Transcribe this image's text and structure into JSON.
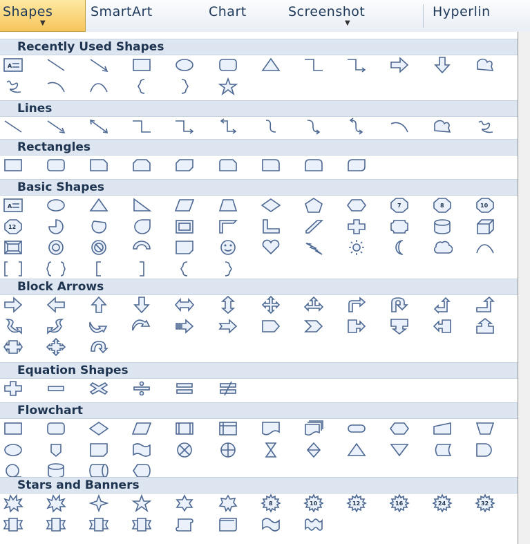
{
  "ribbon": {
    "shapes_label": "Shapes",
    "smartart_label": "SmartArt",
    "chart_label": "Chart",
    "screenshot_label": "Screenshot",
    "hyperlink_label": "Hyperlin"
  },
  "sections": [
    {
      "title": "Recently Used Shapes",
      "rows": [
        [
          "text-box",
          "line",
          "arrow-line",
          "rectangle",
          "oval",
          "rounded-rectangle",
          "triangle",
          "elbow-connector",
          "elbow-arrow-connector",
          "right-arrow",
          "down-arrow",
          "freeform"
        ],
        [
          "scribble",
          "curve",
          "arc",
          "left-brace",
          "right-brace",
          "star-5-point"
        ]
      ]
    },
    {
      "title": "Lines",
      "rows": [
        [
          "line",
          "arrow-line",
          "double-arrow-line",
          "elbow-connector",
          "elbow-arrow-connector",
          "elbow-double-arrow-connector",
          "curved-connector",
          "curved-arrow-connector",
          "curved-double-arrow-connector",
          "curve",
          "freeform",
          "scribble"
        ]
      ]
    },
    {
      "title": "Rectangles",
      "rows": [
        [
          "rectangle",
          "rounded-rectangle",
          "snip-single-corner-rectangle",
          "snip-same-side-corner-rectangle",
          "snip-diagonal-corner-rectangle",
          "snip-and-round-single-corner-rectangle",
          "round-single-corner-rectangle",
          "round-same-side-corner-rectangle",
          "round-diagonal-corner-rectangle"
        ]
      ]
    },
    {
      "title": "Basic Shapes",
      "rows": [
        [
          "text-box",
          "oval",
          "isosceles-triangle",
          "right-triangle",
          "parallelogram",
          "trapezoid",
          "diamond",
          "pentagon",
          "hexagon",
          "heptagon",
          "octagon",
          "decagon"
        ],
        [
          "dodecagon",
          "pie",
          "chord",
          "teardrop",
          "frame",
          "half-frame",
          "l-shape",
          "diagonal-stripe",
          "cross",
          "plaque",
          "can",
          "cube"
        ],
        [
          "bevel",
          "donut",
          "no-symbol",
          "block-arc",
          "folded-corner",
          "smiley-face",
          "heart",
          "lightning-bolt",
          "sun",
          "moon",
          "cloud",
          "arc"
        ],
        [
          "double-bracket",
          "double-brace",
          "left-bracket",
          "right-bracket",
          "left-brace",
          "right-brace"
        ]
      ]
    },
    {
      "title": "Block Arrows",
      "rows": [
        [
          "right-arrow",
          "left-arrow",
          "up-arrow",
          "down-arrow",
          "left-right-arrow",
          "up-down-arrow",
          "quad-arrow",
          "left-right-up-arrow",
          "bent-arrow",
          "u-turn-arrow",
          "left-up-arrow",
          "bent-up-arrow"
        ],
        [
          "curved-right-arrow",
          "curved-left-arrow",
          "curved-up-arrow",
          "curved-down-arrow",
          "striped-right-arrow",
          "notched-right-arrow",
          "pentagon-arrow",
          "chevron",
          "right-arrow-callout",
          "down-arrow-callout",
          "left-arrow-callout",
          "up-arrow-callout"
        ],
        [
          "left-right-arrow-callout",
          "quad-arrow-callout",
          "circular-arrow"
        ]
      ]
    },
    {
      "title": "Equation Shapes",
      "rows": [
        [
          "plus",
          "minus",
          "multiply",
          "division",
          "equal",
          "not-equal"
        ]
      ]
    },
    {
      "title": "Flowchart",
      "rows": [
        [
          "process",
          "alternate-process",
          "decision",
          "data",
          "predefined-process",
          "internal-storage",
          "document",
          "multidocument",
          "terminator",
          "preparation",
          "manual-input",
          "manual-operation"
        ],
        [
          "connector",
          "off-page-connector",
          "card",
          "punched-tape",
          "summing-junction",
          "or",
          "collate",
          "sort",
          "extract",
          "merge",
          "stored-data",
          "delay"
        ],
        [
          "sequential-access-storage",
          "magnetic-disk",
          "direct-access-storage",
          "display"
        ]
      ]
    },
    {
      "title": "Stars and Banners",
      "rows": [
        [
          "explosion-1",
          "explosion-2",
          "star-4-point",
          "star-5-point",
          "star-6-point",
          "star-7-point",
          "star-8-point",
          "star-10-point",
          "star-12-point",
          "star-16-point",
          "star-24-point",
          "star-32-point"
        ],
        [
          "up-ribbon",
          "down-ribbon",
          "curved-up-ribbon",
          "curved-down-ribbon",
          "vertical-scroll",
          "horizontal-scroll",
          "wave",
          "double-wave"
        ]
      ]
    }
  ],
  "shape_labels": {
    "text-box": "A",
    "heptagon": "7",
    "octagon": "8",
    "decagon": "10",
    "dodecagon": "12",
    "star-8-point": "8",
    "star-10-point": "10",
    "star-12-point": "12",
    "star-16-point": "16",
    "star-24-point": "24",
    "star-32-point": "32"
  }
}
